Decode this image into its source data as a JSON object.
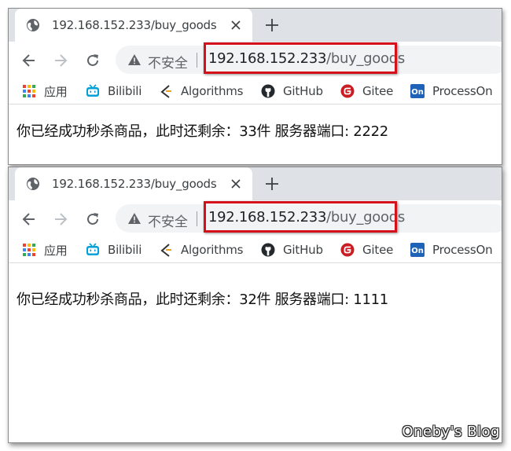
{
  "windows": [
    {
      "tab_title": "192.168.152.233/buy_goods",
      "insecure_label": "不安全",
      "url_host": "192.168.152.233",
      "url_path": "/buy_goods",
      "bookmarks": [
        {
          "label": "应用",
          "icon": "apps-grid-icon"
        },
        {
          "label": "Bilibili",
          "icon": "bilibili-icon"
        },
        {
          "label": "Algorithms",
          "icon": "algorithms-icon"
        },
        {
          "label": "GitHub",
          "icon": "github-icon"
        },
        {
          "label": "Gitee",
          "icon": "gitee-icon"
        },
        {
          "label": "ProcessOn",
          "icon": "processon-icon"
        }
      ],
      "content": "你已经成功秒杀商品，此时还剩余：33件 服务器端口: 2222"
    },
    {
      "tab_title": "192.168.152.233/buy_goods",
      "insecure_label": "不安全",
      "url_host": "192.168.152.233",
      "url_path": "/buy_goods",
      "bookmarks": [
        {
          "label": "应用",
          "icon": "apps-grid-icon"
        },
        {
          "label": "Bilibili",
          "icon": "bilibili-icon"
        },
        {
          "label": "Algorithms",
          "icon": "algorithms-icon"
        },
        {
          "label": "GitHub",
          "icon": "github-icon"
        },
        {
          "label": "Gitee",
          "icon": "gitee-icon"
        },
        {
          "label": "ProcessOn",
          "icon": "processon-icon"
        }
      ],
      "content": "你已经成功秒杀商品，此时还剩余：32件 服务器端口: 1111"
    }
  ],
  "watermark": "Oneby's Blog",
  "colors": {
    "highlight_border": "#d4111b",
    "tabstrip": "#dee1e6",
    "omnibox": "#f1f3f4"
  }
}
